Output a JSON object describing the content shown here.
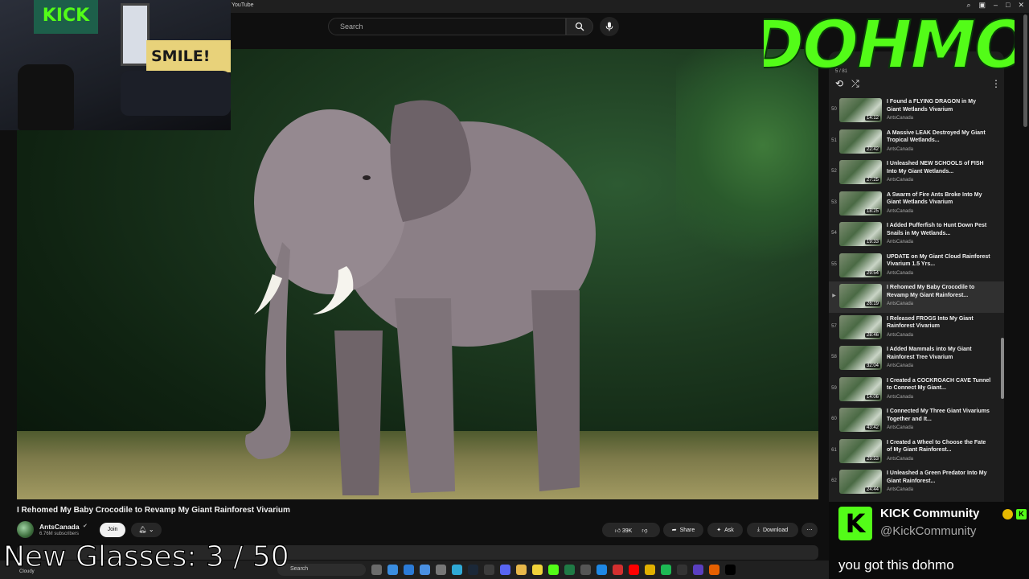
{
  "browser": {
    "tab_title": "YouTube"
  },
  "header": {
    "search_placeholder": "Search"
  },
  "webcam": {
    "poster_text": "KICK",
    "sign_text": "SMILE!"
  },
  "logo": {
    "text": "DOHMO",
    "color": "#53fc18"
  },
  "playlist": {
    "sub_text": "5 / 81",
    "items": [
      {
        "num": "50",
        "title": "I Found a FLYING DRAGON in My Giant Wetlands Vivarium",
        "channel": "AntsCanada",
        "duration": "14:12",
        "active": false
      },
      {
        "num": "51",
        "title": "A Massive LEAK Destroyed My Giant Tropical Wetlands...",
        "channel": "AntsCanada",
        "duration": "22:42",
        "active": false
      },
      {
        "num": "52",
        "title": "I Unleashed NEW SCHOOLS of FISH Into My Giant Wetlands...",
        "channel": "AntsCanada",
        "duration": "27:25",
        "active": false
      },
      {
        "num": "53",
        "title": "A Swarm of Fire Ants Broke Into My Giant Wetlands Vivarium",
        "channel": "AntsCanada",
        "duration": "18:25",
        "active": false
      },
      {
        "num": "54",
        "title": "I Added Pufferfish to Hunt Down Pest Snails in My Wetlands...",
        "channel": "AntsCanada",
        "duration": "19:33",
        "active": false
      },
      {
        "num": "55",
        "title": "UPDATE on My Giant Cloud Rainforest Vivarium 1.5 Yrs...",
        "channel": "AntsCanada",
        "duration": "29:54",
        "active": false
      },
      {
        "num": "▶",
        "title": "I Rehomed My Baby Crocodile to Revamp My Giant Rainforest...",
        "channel": "AntsCanada",
        "duration": "26:19",
        "active": true
      },
      {
        "num": "57",
        "title": "I Released FROGS Into My Giant Rainforest Vivarium",
        "channel": "AntsCanada",
        "duration": "28:46",
        "active": false
      },
      {
        "num": "58",
        "title": "I Added Mammals into My Giant Rainforest Tree Vivarium",
        "channel": "AntsCanada",
        "duration": "32:04",
        "active": false
      },
      {
        "num": "59",
        "title": "I Created a COCKROACH CAVE Tunnel to Connect My Giant...",
        "channel": "AntsCanada",
        "duration": "14:06",
        "active": false
      },
      {
        "num": "60",
        "title": "I Connected My Three Giant Vivariums Together and It...",
        "channel": "AntsCanada",
        "duration": "43:42",
        "active": false
      },
      {
        "num": "61",
        "title": "I Created a Wheel to Choose the Fate of My Giant Rainforest...",
        "channel": "AntsCanada",
        "duration": "29:53",
        "active": false
      },
      {
        "num": "62",
        "title": "I Unleashed a Green Predator Into My Giant Rainforest...",
        "channel": "AntsCanada",
        "duration": "24:44",
        "active": false
      }
    ]
  },
  "video": {
    "title": "I Rehomed My Baby Crocodile to Revamp My Giant Rainforest Vivarium",
    "channel": "AntsCanada",
    "subscribers": "6.76M subscribers",
    "join_label": "Join",
    "likes": "39K",
    "share_label": "Share",
    "ask_label": "Ask",
    "download_label": "Download"
  },
  "taskbar": {
    "search_label": "Search",
    "weather": "Cloudy"
  },
  "overlay": {
    "counter_text": "New Glasses:  3 / 50"
  },
  "kick": {
    "logo_letter": "K",
    "name": "KICK Community",
    "handle": "@KickCommunity",
    "message": "you got this dohmo"
  }
}
